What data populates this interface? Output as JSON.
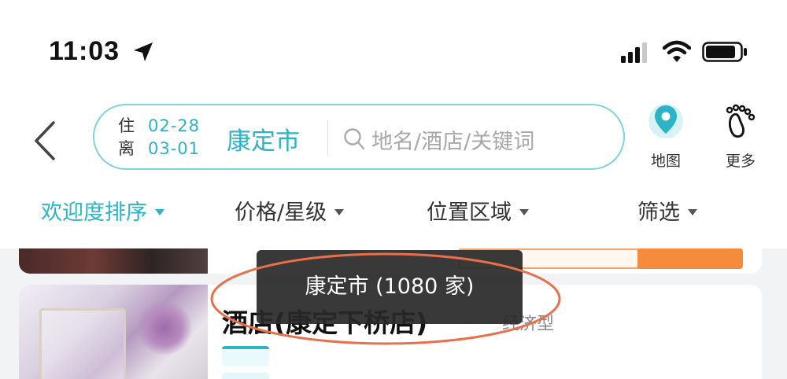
{
  "status_bar": {
    "time": "11:03"
  },
  "search": {
    "checkin_label": "住",
    "checkout_label": "离",
    "checkin_date": "02-28",
    "checkout_date": "03-01",
    "city": "康定市",
    "placeholder": "地名/酒店/关键词"
  },
  "actions": {
    "map_label": "地图",
    "more_label": "更多"
  },
  "filters": [
    {
      "label": "欢迎度排序",
      "active": true
    },
    {
      "label": "价格/星级",
      "active": false
    },
    {
      "label": "位置区域",
      "active": false
    },
    {
      "label": "筛选",
      "active": false
    }
  ],
  "hotel": {
    "name": "酒店(康定下桥店)",
    "type": "经济型"
  },
  "tooltip": {
    "text": "康定市 (1080 家)"
  },
  "colors": {
    "accent": "#2bb3c6",
    "annotation": "#e8704a",
    "tag_orange": "#f58b3c"
  }
}
